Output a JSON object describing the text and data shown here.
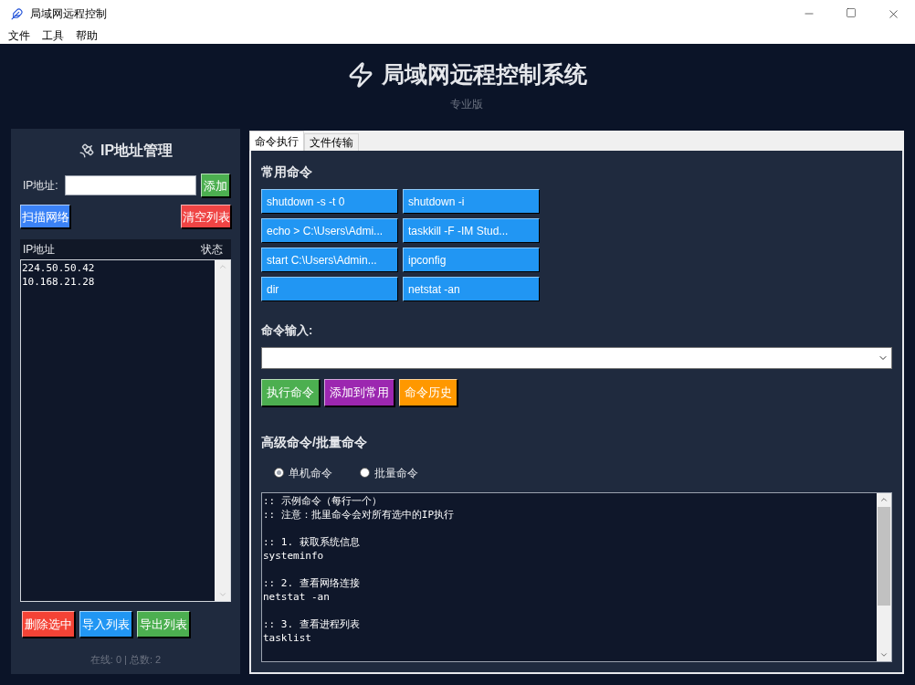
{
  "window": {
    "title": "局域网远程控制"
  },
  "menu": [
    {
      "label": "文件"
    },
    {
      "label": "工具"
    },
    {
      "label": "帮助"
    }
  ],
  "header": {
    "title": "局域网远程控制系统",
    "subtitle": "专业版"
  },
  "ip_panel": {
    "title": "IP地址管理",
    "ip_label": "IP地址:",
    "add_button": {
      "label": "添加",
      "color": "#4caf50"
    },
    "top_buttons": [
      {
        "label": "扫描网络",
        "color": "#3b82f6"
      },
      {
        "label": "清空列表",
        "color": "#ef4444"
      }
    ],
    "columns": [
      "IP地址",
      "状态"
    ],
    "rows": [
      {
        "ip": "224.50.50.42"
      },
      {
        "ip": "10.168.21.28"
      }
    ],
    "bottom_buttons": [
      {
        "label": "删除选中",
        "color": "#f44336"
      },
      {
        "label": "导入列表",
        "color": "#2196f3"
      },
      {
        "label": "导出列表",
        "color": "#4caf50"
      }
    ],
    "status": "在线: 0 | 总数: 2"
  },
  "tabs": [
    {
      "label": "命令执行",
      "selected": true
    },
    {
      "label": "文件传输",
      "selected": false
    }
  ],
  "common_commands": {
    "title": "常用命令",
    "items": [
      "shutdown -s -t 0",
      "shutdown -i",
      "echo > C:\\Users\\Admi...",
      "taskkill -F -IM Stud...",
      "start C:\\Users\\Admin...",
      "ipconfig",
      "dir",
      "netstat -an"
    ]
  },
  "command_input": {
    "label": "命令输入:"
  },
  "action_buttons": [
    {
      "label": "执行命令",
      "color": "#4caf50"
    },
    {
      "label": "添加到常用",
      "color": "#9c27b0"
    },
    {
      "label": "命令历史",
      "color": "#ff9800"
    }
  ],
  "advanced": {
    "title": "高级命令/批量命令",
    "radios": [
      {
        "label": "单机命令",
        "selected": true
      },
      {
        "label": "批量命令",
        "selected": false
      }
    ],
    "script_blocks": [
      {
        "lines": [
          ":: 示例命令（每行一个）",
          ":: 注意：批里命令会对所有选中的IP执行"
        ]
      },
      {
        "lines": [
          ":: 1. 获取系统信息",
          "systeminfo"
        ]
      },
      {
        "lines": [
          ":: 2. 查看网络连接",
          "netstat -an"
        ]
      },
      {
        "lines": [
          ":: 3. 查看进程列表",
          "tasklist"
        ]
      }
    ]
  }
}
